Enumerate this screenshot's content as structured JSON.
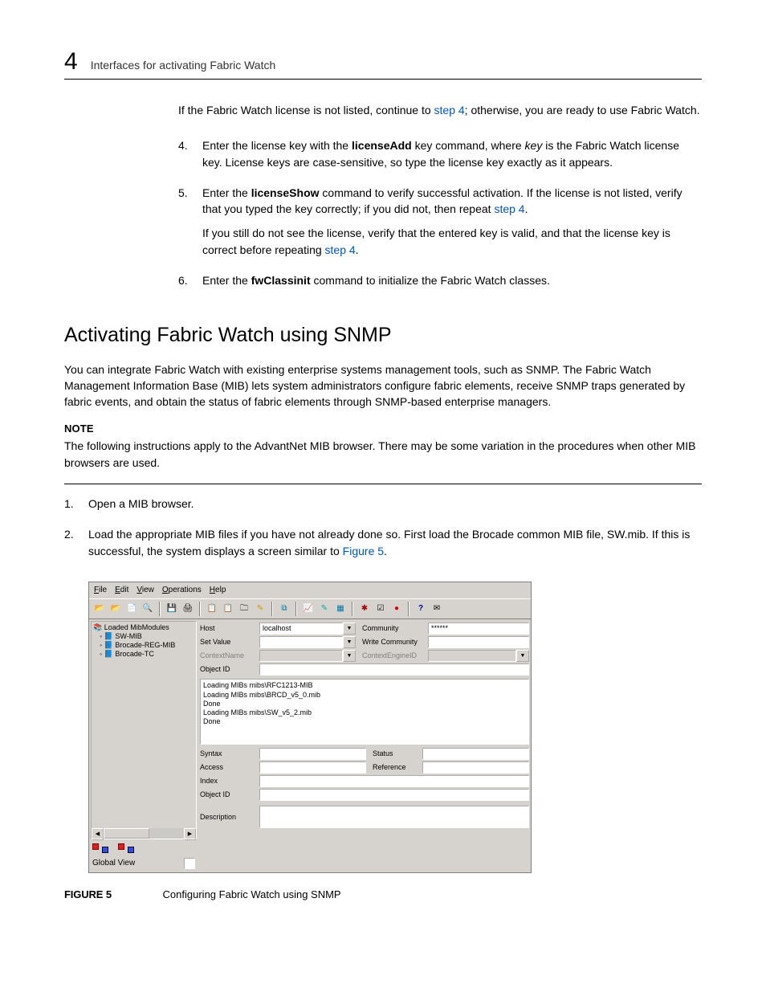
{
  "header": {
    "chapter": "4",
    "title": "Interfaces for activating Fabric Watch"
  },
  "intro": {
    "t1": "If the Fabric Watch license is not listed, continue to ",
    "link1": "step 4",
    "t2": "; otherwise, you are ready to use Fabric Watch."
  },
  "steps": {
    "s4": {
      "num": "4.",
      "t1": "Enter the license key with the ",
      "b1": "licenseAdd",
      "t2": " key command, where ",
      "i1": "key",
      "t3": " is the Fabric Watch license key. License keys are case-sensitive, so type the license key exactly as it appears."
    },
    "s5": {
      "num": "5.",
      "t1": "Enter the ",
      "b1": "licenseShow",
      "t2": " command to verify successful activation. If the license is not listed, verify that you typed the key correctly; if you did not, then repeat ",
      "link1": "step 4",
      "t3": ".",
      "p2a": "If you still do not see the license, verify that the entered key is valid, and that the license key is correct before repeating ",
      "p2link": "step 4",
      "p2b": "."
    },
    "s6": {
      "num": "6.",
      "t1": "Enter the ",
      "b1": "fwClassinit",
      "t2": " command to initialize the Fabric Watch classes."
    }
  },
  "section_heading": "Activating Fabric Watch using SNMP",
  "para1": "You can integrate Fabric Watch with existing enterprise systems management tools, such as SNMP. The Fabric Watch Management Information Base (MIB) lets system administrators configure fabric elements, receive SNMP traps generated by fabric events, and obtain the status of fabric elements through SNMP-based enterprise managers.",
  "note": {
    "label": "NOTE",
    "text": "The following instructions apply to the AdvantNet MIB browser. There may be some variation in the procedures when other MIB browsers are used."
  },
  "steps2": {
    "s1": {
      "num": "1.",
      "t": "Open a MIB browser."
    },
    "s2": {
      "num": "2.",
      "t1": "Load the appropriate MIB files if you have not already done so. First load the Brocade common MIB file, SW.mib. If this is successful, the system displays a screen similar to ",
      "link": "Figure 5",
      "t2": "."
    }
  },
  "mib": {
    "menu": {
      "file": "File",
      "edit": "Edit",
      "view": "View",
      "operations": "Operations",
      "help": "Help"
    },
    "tree": {
      "root": "Loaded MibModules",
      "children": [
        "SW-MIB",
        "Brocade-REG-MIB",
        "Brocade-TC"
      ]
    },
    "global_view": "Global View",
    "fields": {
      "host": "Host",
      "host_val": "localhost",
      "community": "Community",
      "community_val": "******",
      "setvalue": "Set Value",
      "write_community": "Write Community",
      "contextname": "ContextName",
      "contextengineid": "ContextEngineID",
      "object_id": "Object ID",
      "syntax": "Syntax",
      "status": "Status",
      "access": "Access",
      "reference": "Reference",
      "index": "Index",
      "object_id2": "Object ID",
      "description": "Description"
    },
    "log": {
      "l1": "Loading MIBs mibs\\RFC1213-MIB",
      "l2": "Loading MIBs mibs\\BRCD_v5_0.mib",
      "l3": "Done",
      "l4": "Loading MIBs mibs\\SW_v5_2.mib",
      "l5": "Done"
    }
  },
  "caption": {
    "fig": "FIGURE 5",
    "title": "Configuring Fabric Watch using SNMP"
  }
}
